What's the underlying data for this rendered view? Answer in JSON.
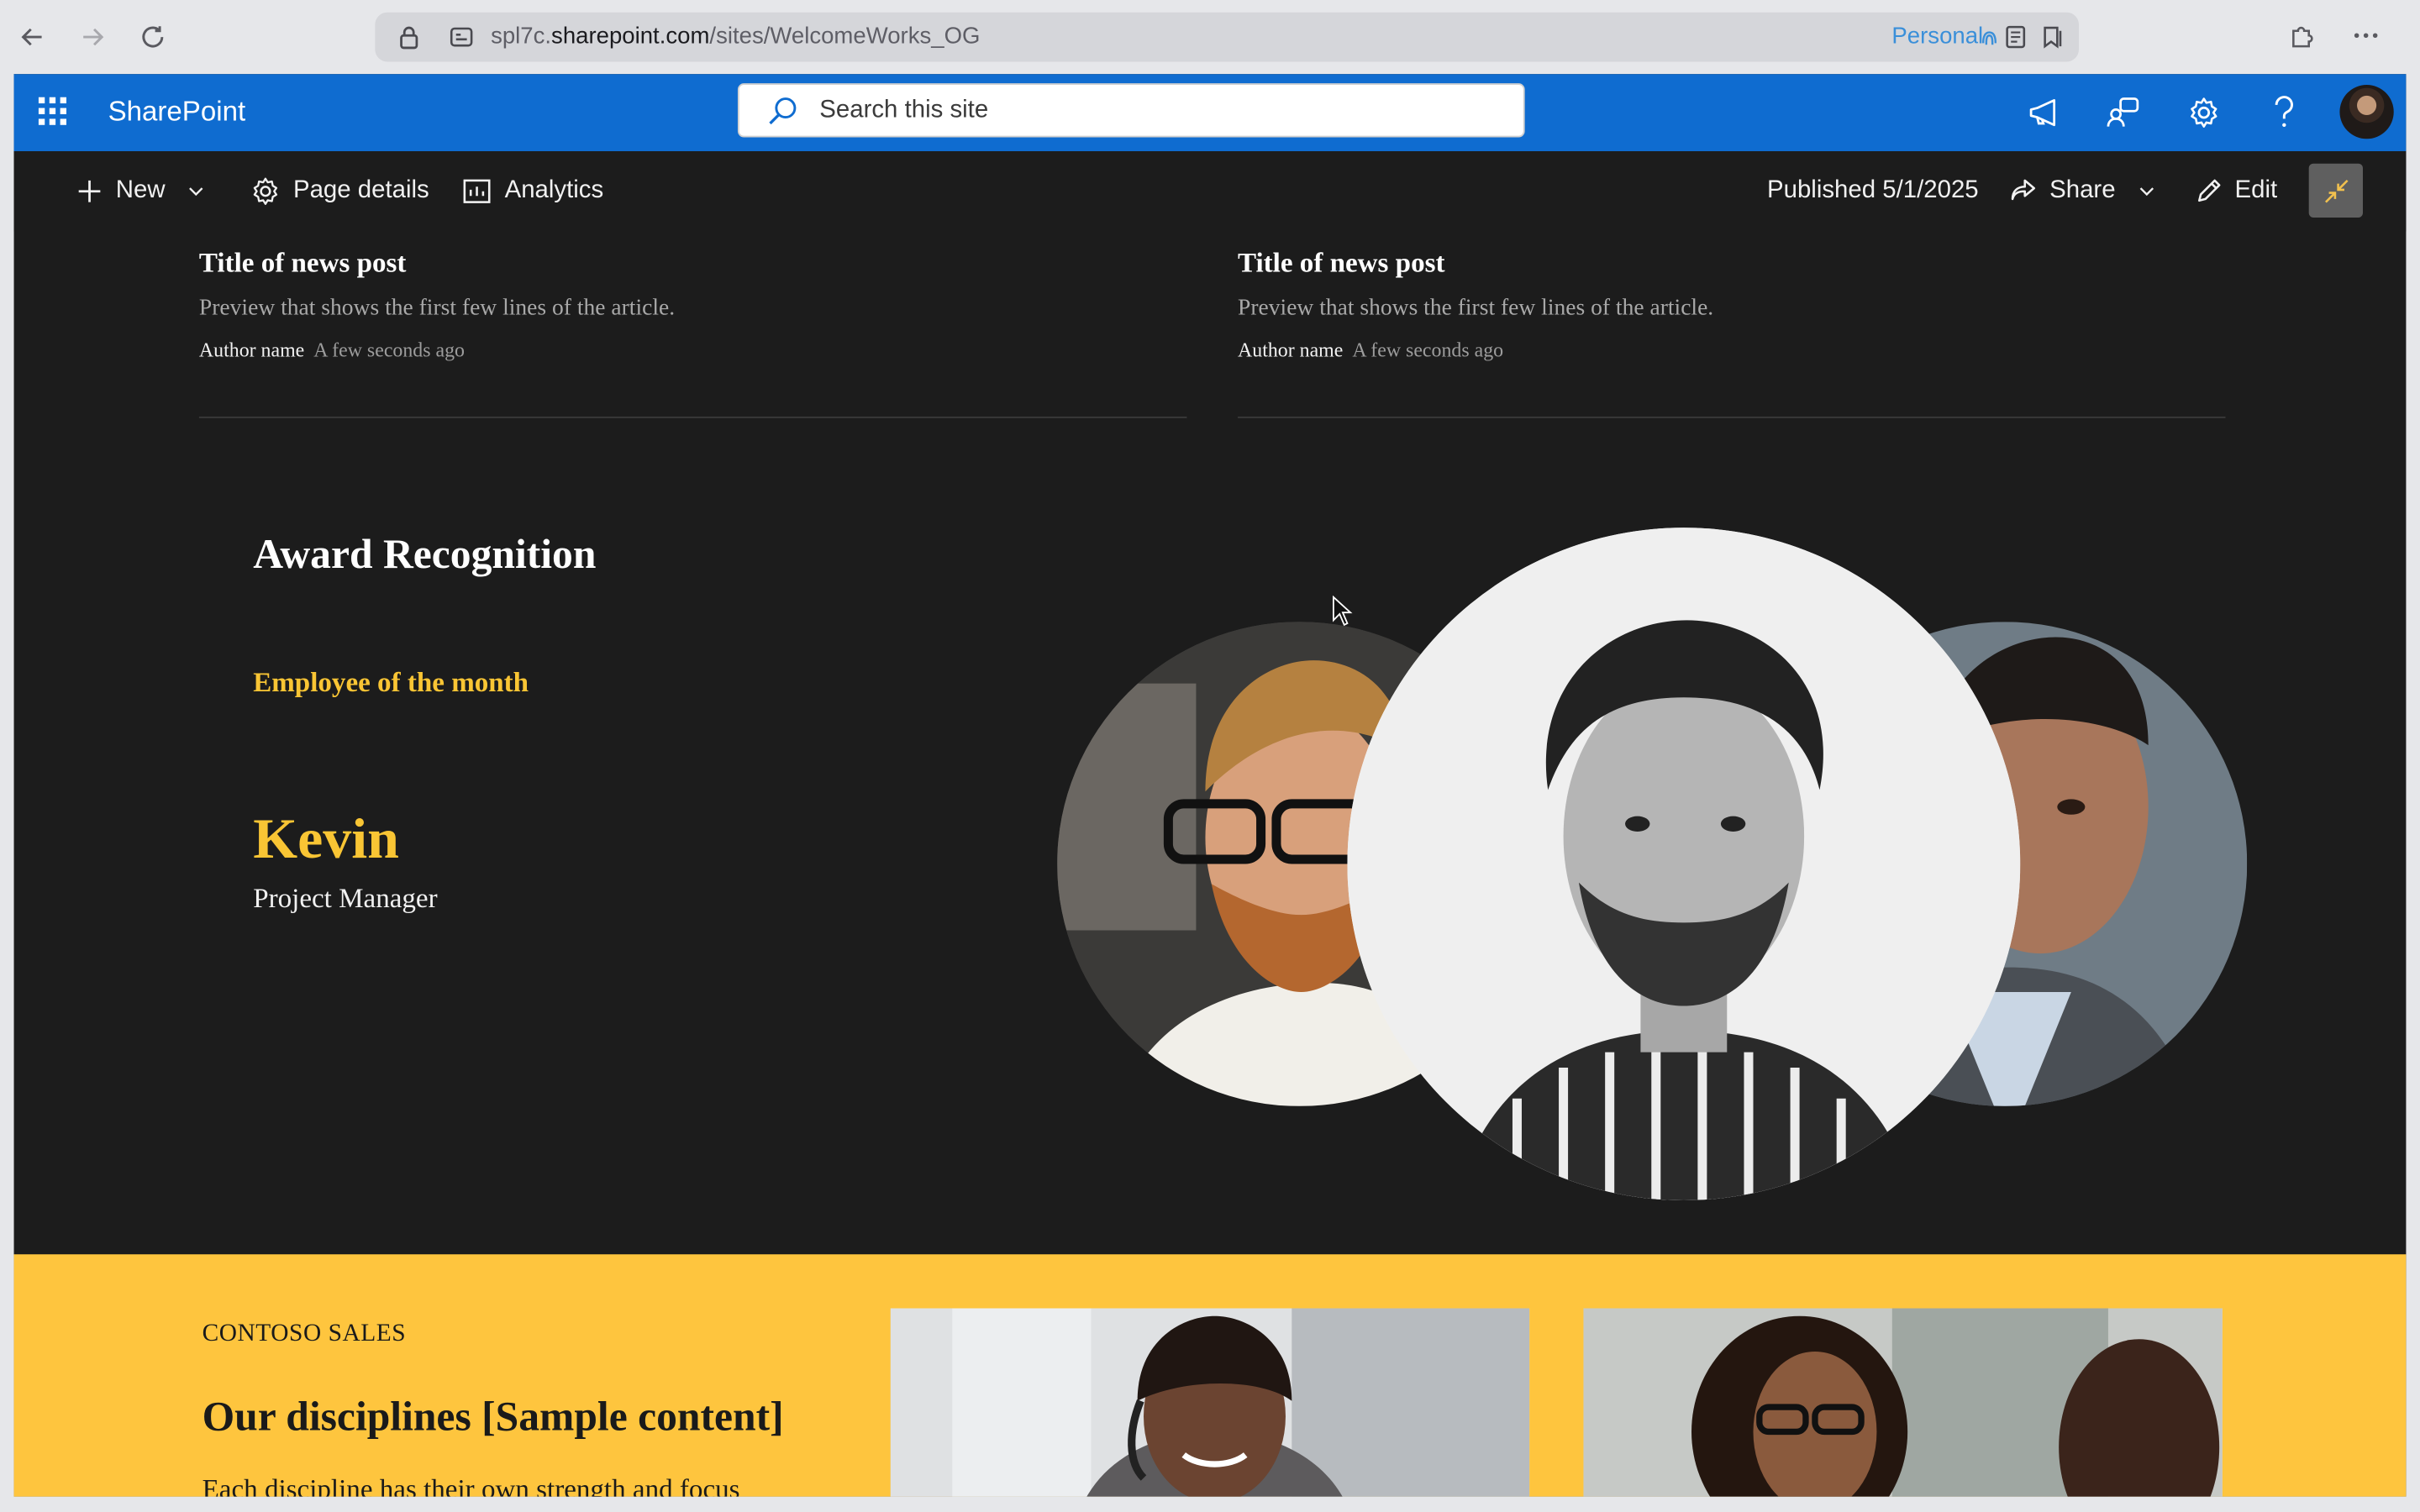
{
  "browser": {
    "url_prefix": "spl7c.",
    "url_domain": "sharepoint.com",
    "url_path": "/sites/WelcomeWorks_OG",
    "profile_label": "Personal"
  },
  "suitebar": {
    "brand": "SharePoint",
    "search_placeholder": "Search this site"
  },
  "command_bar": {
    "new_label": "New",
    "page_details_label": "Page details",
    "analytics_label": "Analytics",
    "published_label": "Published 5/1/2025",
    "share_label": "Share",
    "edit_label": "Edit"
  },
  "news": [
    {
      "title": "Title of news post",
      "preview": "Preview that shows the first few lines of the article.",
      "author": "Author name",
      "time": "A few seconds ago"
    },
    {
      "title": "Title of news post",
      "preview": "Preview that shows the first few lines of the article.",
      "author": "Author name",
      "time": "A few seconds ago"
    }
  ],
  "award": {
    "title": "Award Recognition",
    "subtitle": "Employee of the month",
    "name": "Kevin",
    "role": "Project Manager"
  },
  "disciplines": {
    "kicker": "CONTOSO SALES",
    "heading": "Our disciplines [Sample content]",
    "text": "Each discipline has their own strength and focus"
  },
  "colors": {
    "suitebar": "#0f6cd0",
    "accent_yellow": "#fec53e",
    "page_bg": "#1c1c1c"
  }
}
